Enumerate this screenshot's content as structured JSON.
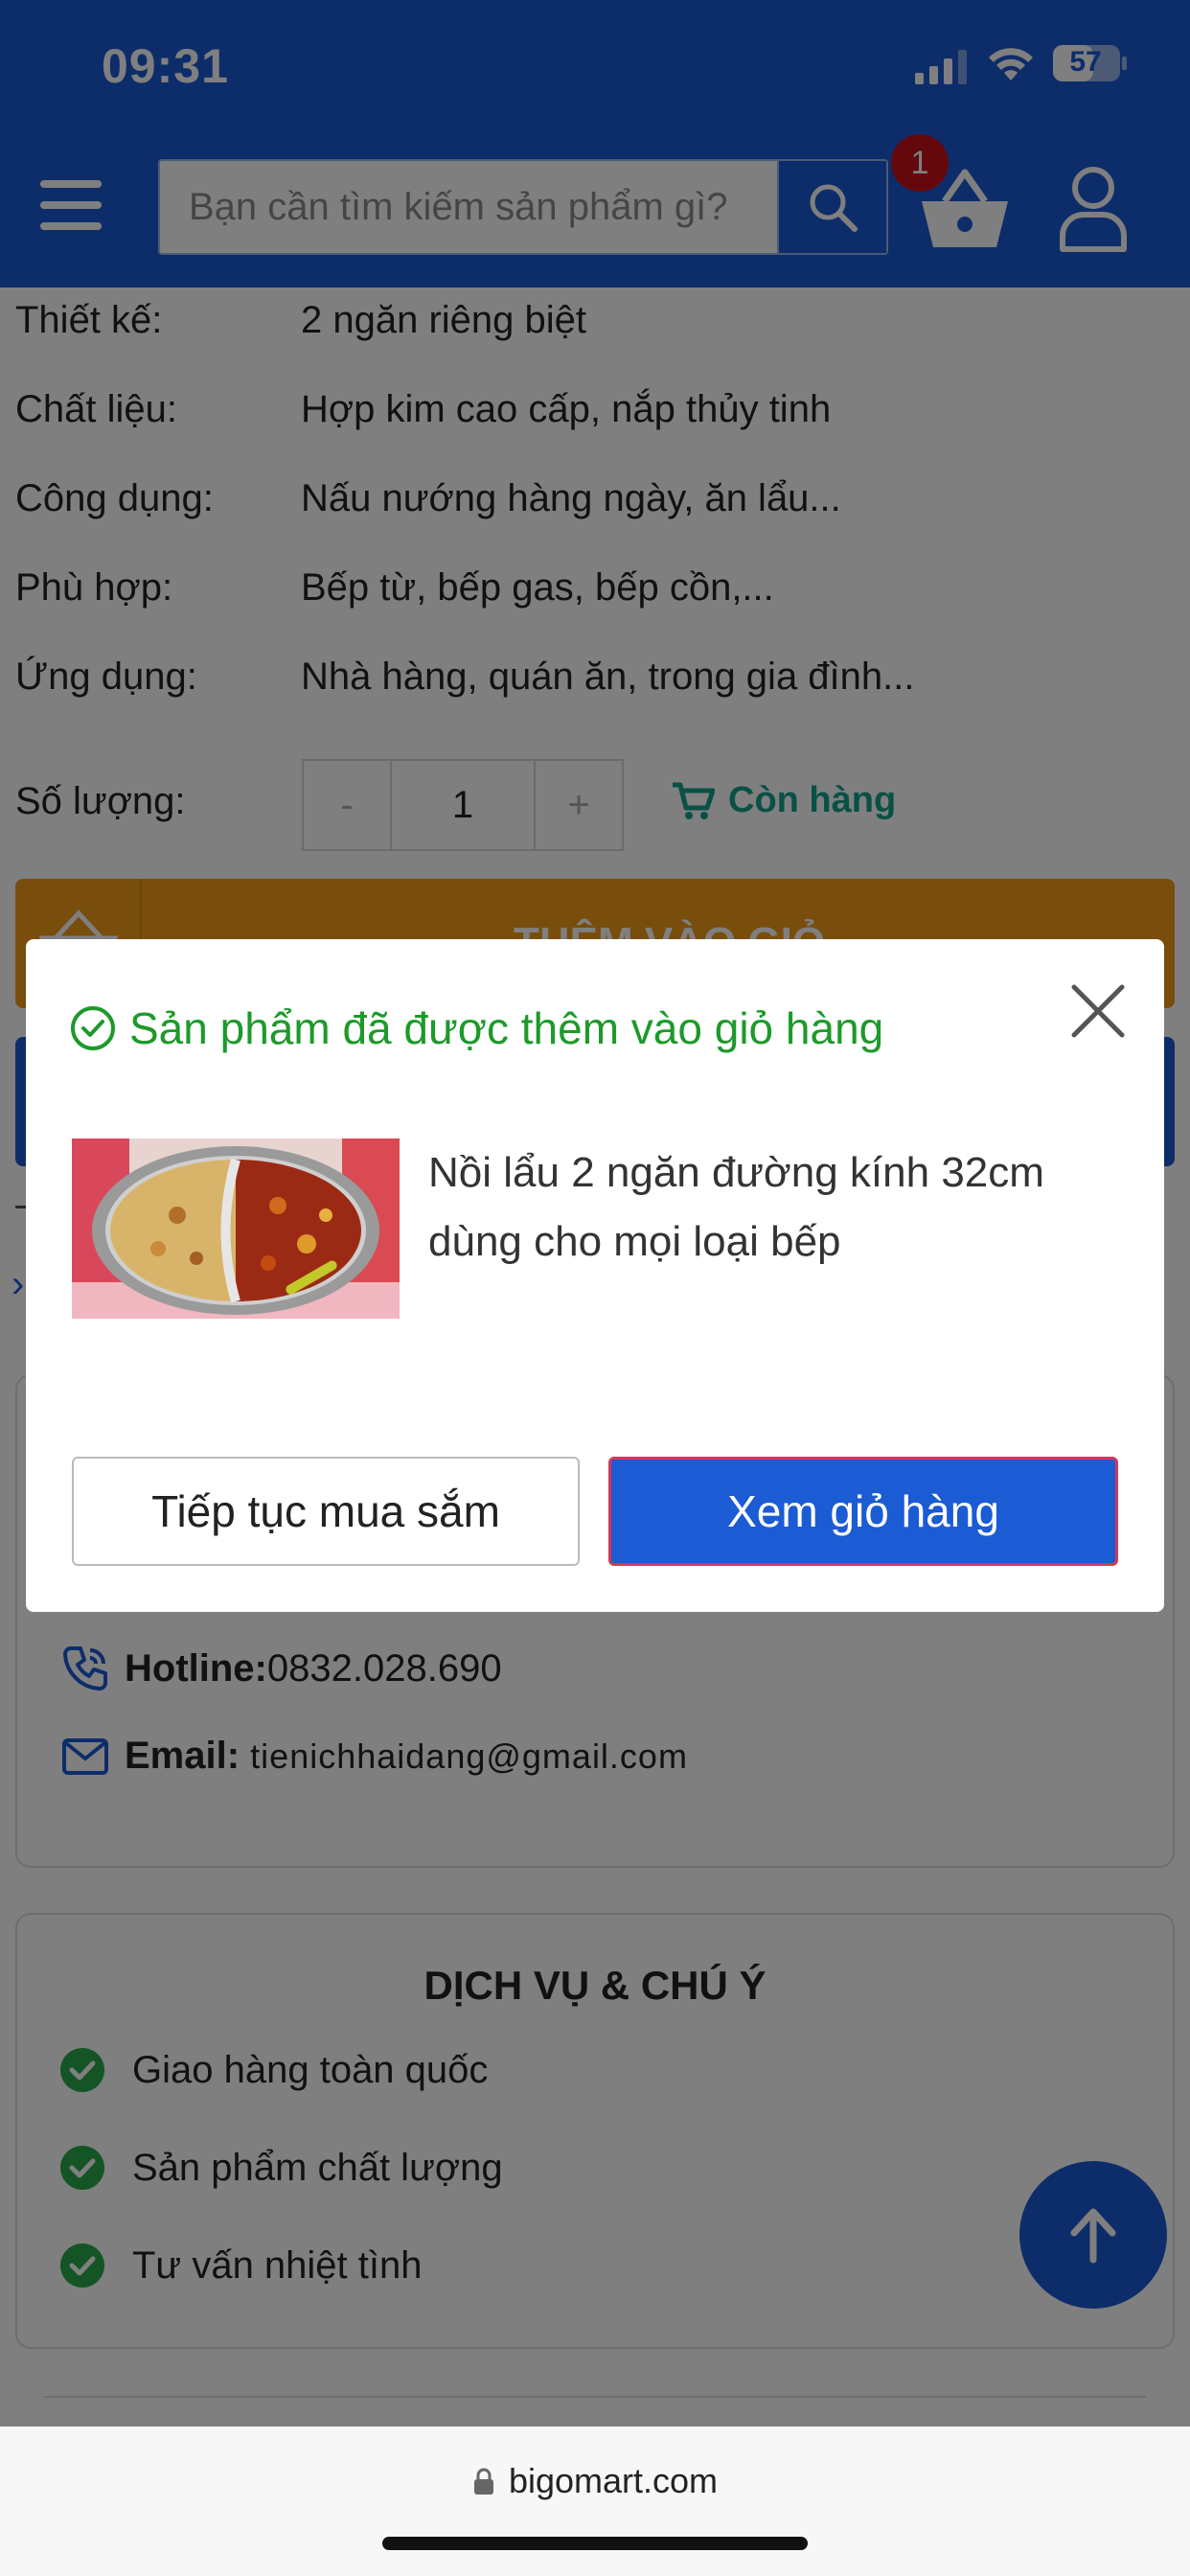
{
  "status_bar": {
    "time": "09:31",
    "battery": "57"
  },
  "header": {
    "search_placeholder": "Bạn cần tìm kiếm sản phẩm gì?",
    "cart_count": "1"
  },
  "specs": [
    {
      "label": "Thiết kế:",
      "value": "2 ngăn riêng biệt"
    },
    {
      "label": "Chất liệu:",
      "value": "Hợp kim cao cấp, nắp thủy tinh"
    },
    {
      "label": "Công dụng:",
      "value": "Nấu nướng hàng ngày, ăn lẩu..."
    },
    {
      "label": "Phù hợp:",
      "value": "Bếp từ, bếp gas, bếp cồn,..."
    },
    {
      "label": "Ứng dụng:",
      "value": "Nhà hàng, quán ăn, trong gia đình..."
    }
  ],
  "quantity": {
    "label": "Số lượng:",
    "minus": "-",
    "value": "1",
    "plus": "+",
    "stock": "Còn hàng"
  },
  "add_to_cart_label": "THÊM VÀO GIỎ",
  "contact": {
    "hotline_label": "Hotline:",
    "hotline_value": "0832.028.690",
    "email_label": "Email:",
    "email_value": "tienichhaidang@gmail.com"
  },
  "services": {
    "title": "DỊCH VỤ & CHÚ Ý",
    "items": [
      "Giao hàng toàn quốc",
      "Sản phẩm chất lượng",
      "Tư vấn nhiệt tình"
    ]
  },
  "modal": {
    "message": "Sản phẩm đã được thêm vào giỏ hàng",
    "product_name": "Nồi lẩu 2 ngăn đường kính 32cm dùng cho mọi loại bếp",
    "continue_label": "Tiếp tục mua sắm",
    "view_cart_label": "Xem giỏ hàng"
  },
  "browser": {
    "url": "bigomart.com"
  },
  "colors": {
    "brand_blue": "#1b5bd4",
    "accent_orange": "#f39a19",
    "success_green": "#1d9a2a",
    "badge_red": "#c8101c"
  }
}
